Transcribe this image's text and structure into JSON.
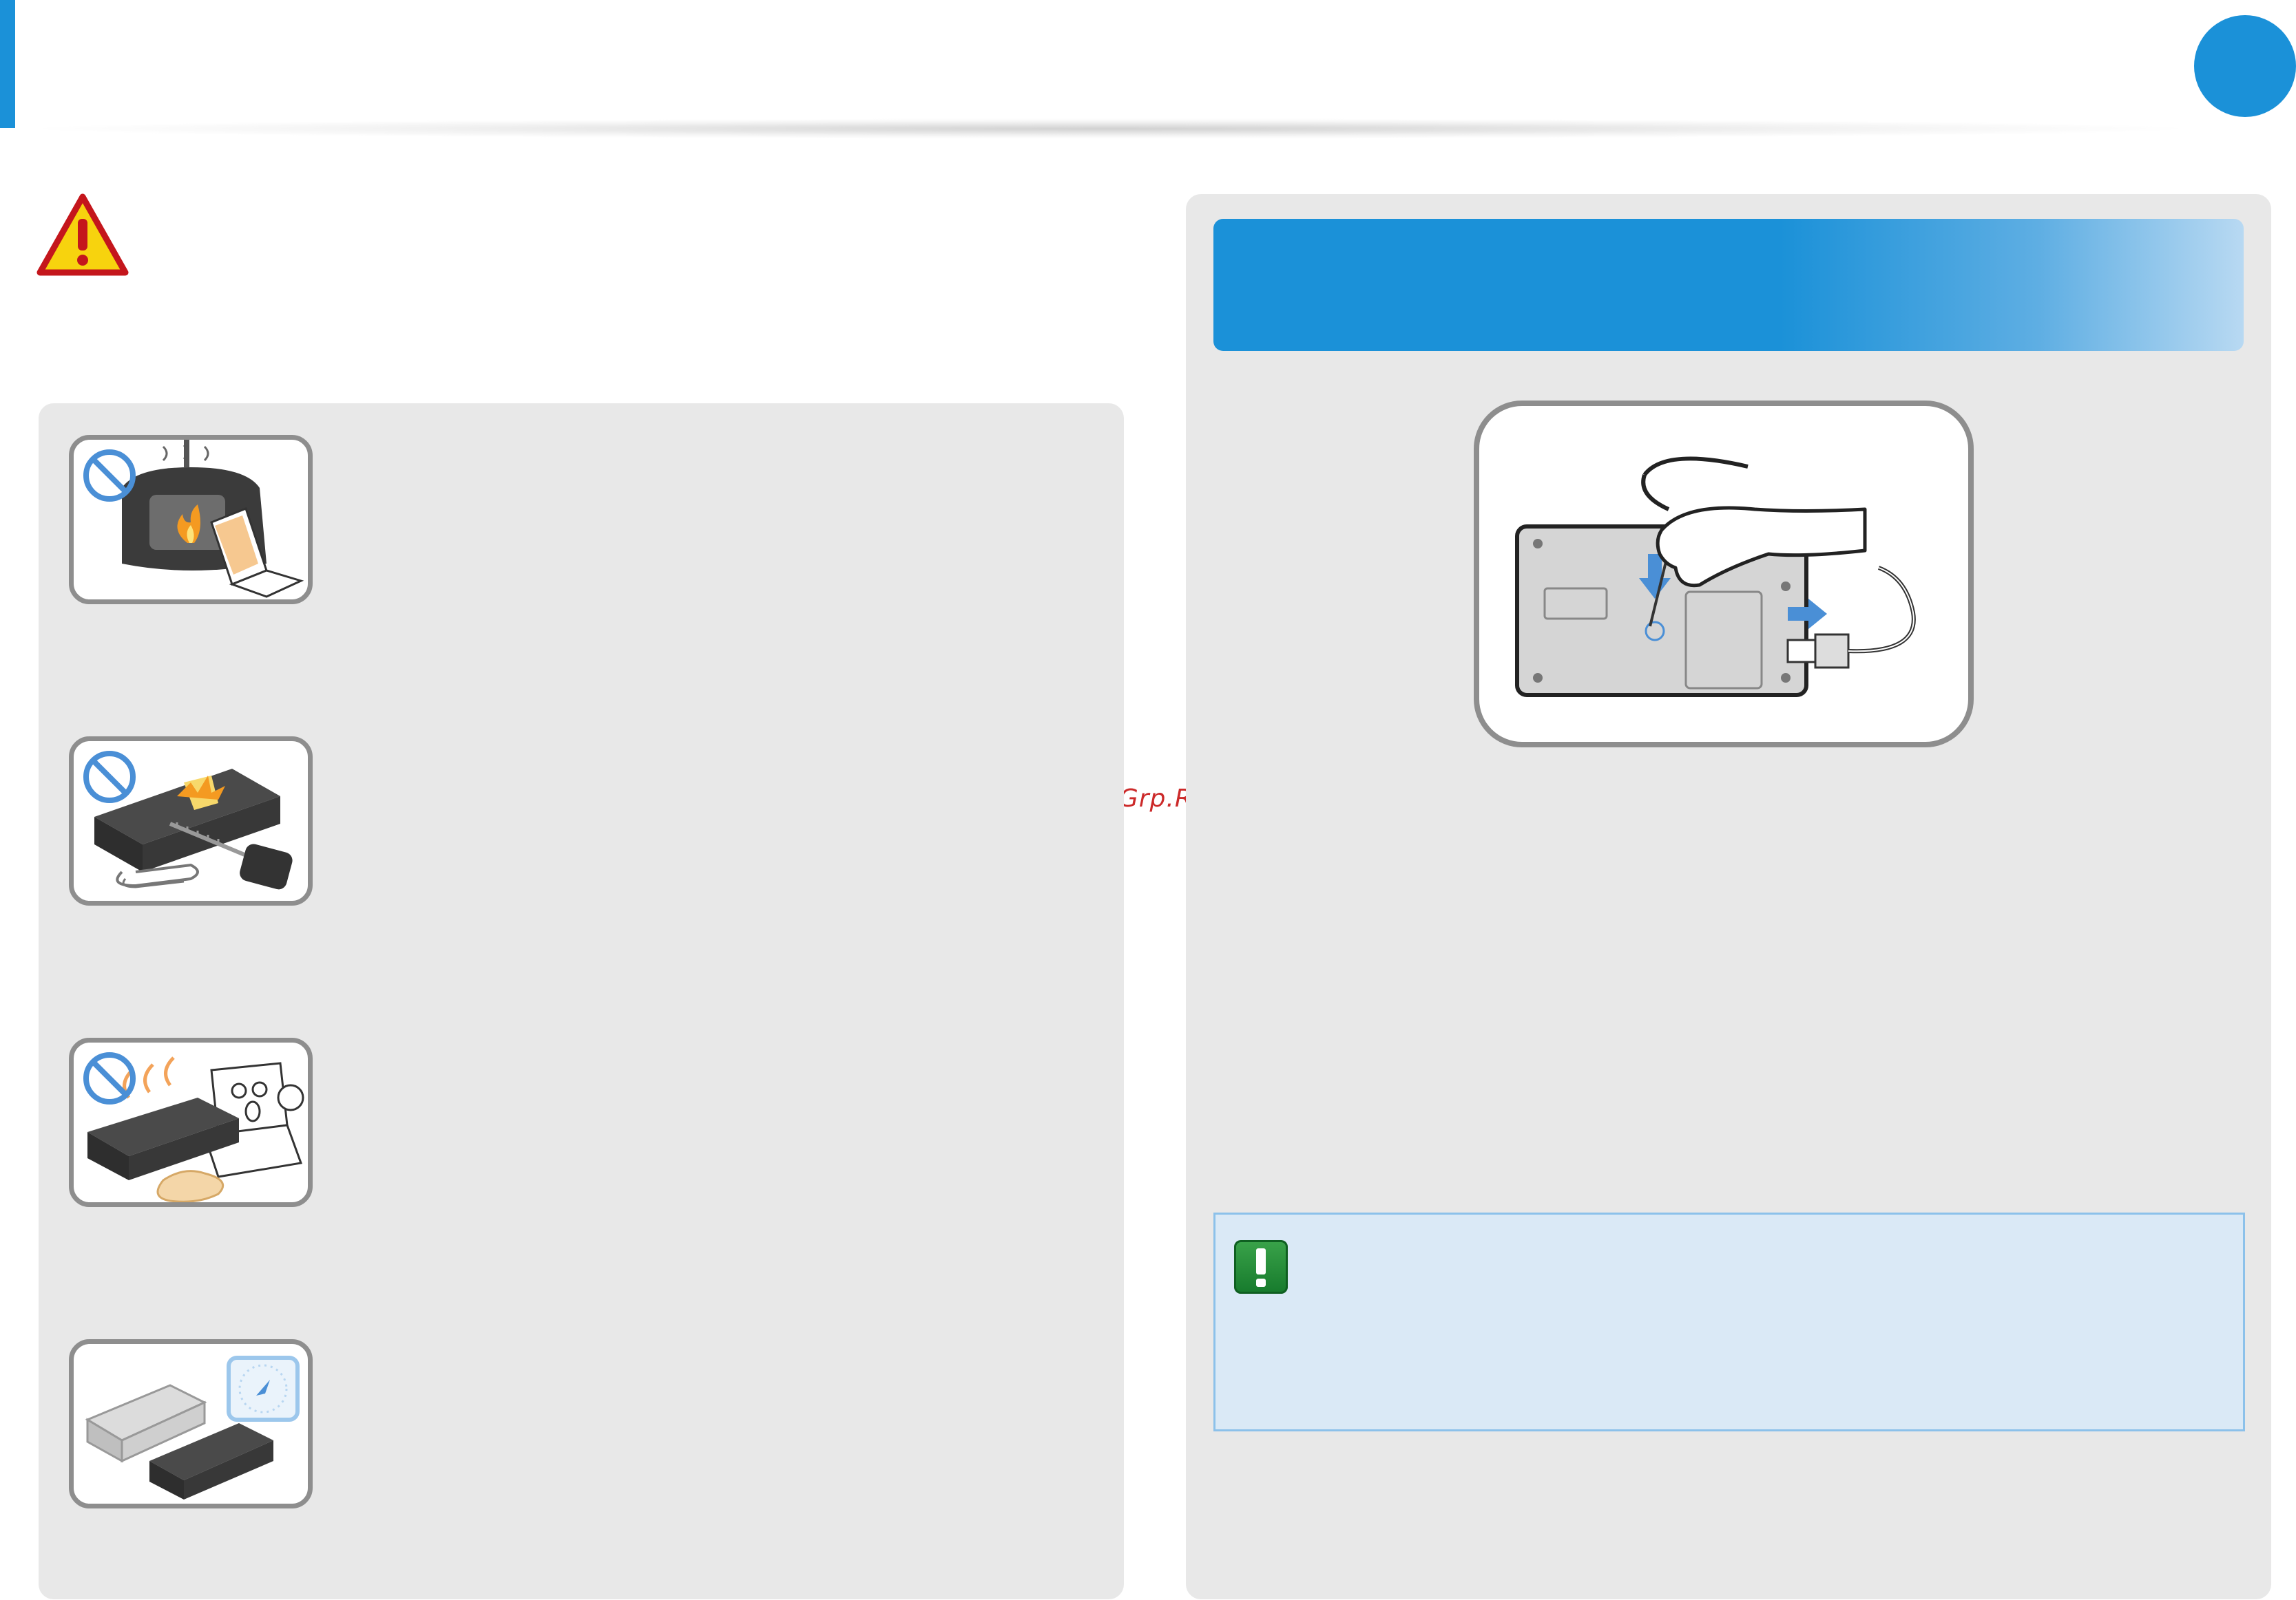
{
  "header": {
    "accent_color": "#1b91d8",
    "page_indicator_color": "#1b91d8"
  },
  "watermark": {
    "text": "McGrp.Ru"
  },
  "warning": {
    "icon": "warning-triangle-icon"
  },
  "left_panel": {
    "items": [
      {
        "illustration": "laptop-near-fire-prohibited-icon"
      },
      {
        "illustration": "battery-short-circuit-prohibited-icon"
      },
      {
        "illustration": "leaking-hot-battery-prohibited-icon"
      },
      {
        "illustration": "battery-replacement-clock-icon"
      }
    ]
  },
  "right_panel": {
    "title_bar_color": "#1b91d8",
    "figure": "emergency-hole-pin-icon",
    "note": {
      "icon": "exclamation-note-icon"
    }
  }
}
